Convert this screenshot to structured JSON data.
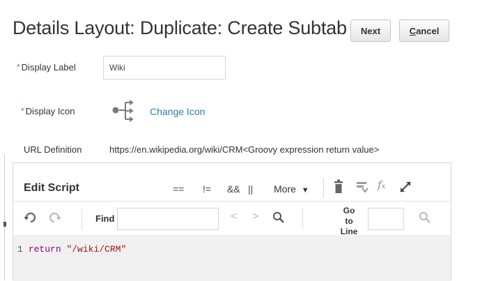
{
  "page": {
    "title": "Details Layout: Duplicate: Create Subtab"
  },
  "actions": {
    "next_label": "Next",
    "cancel_label": "Cancel"
  },
  "form": {
    "required_marker": "*",
    "display_label": {
      "label": "Display Label",
      "value": "Wiki"
    },
    "display_icon": {
      "label": "Display Icon",
      "icon": "split-arrows-icon",
      "change_link": "Change Icon"
    },
    "url_definition": {
      "label": "URL Definition",
      "value": "https://en.wikipedia.org/wiki/CRM<Groovy expression return value>"
    }
  },
  "editor": {
    "title": "Edit Script",
    "operators": [
      "==",
      "!=",
      "&&",
      "||"
    ],
    "more_label": "More",
    "toolbar_icons": [
      "trash-icon",
      "comment-icon",
      "function-icon",
      "expand-icon"
    ],
    "find_bar": {
      "undo_icon": "undo-icon",
      "redo_icon": "redo-icon",
      "find_label": "Find",
      "find_value": "",
      "goto_label": "Go to Line",
      "goto_value": ""
    },
    "code_lines": [
      {
        "number": "1",
        "keyword": "return",
        "string": "\"/wiki/CRM\""
      }
    ]
  },
  "colors": {
    "link": "#2a7fa8",
    "required": "#2a8fbd",
    "keyword": "#8b008b",
    "string": "#a31515",
    "code_background": "#f0f0f0"
  }
}
